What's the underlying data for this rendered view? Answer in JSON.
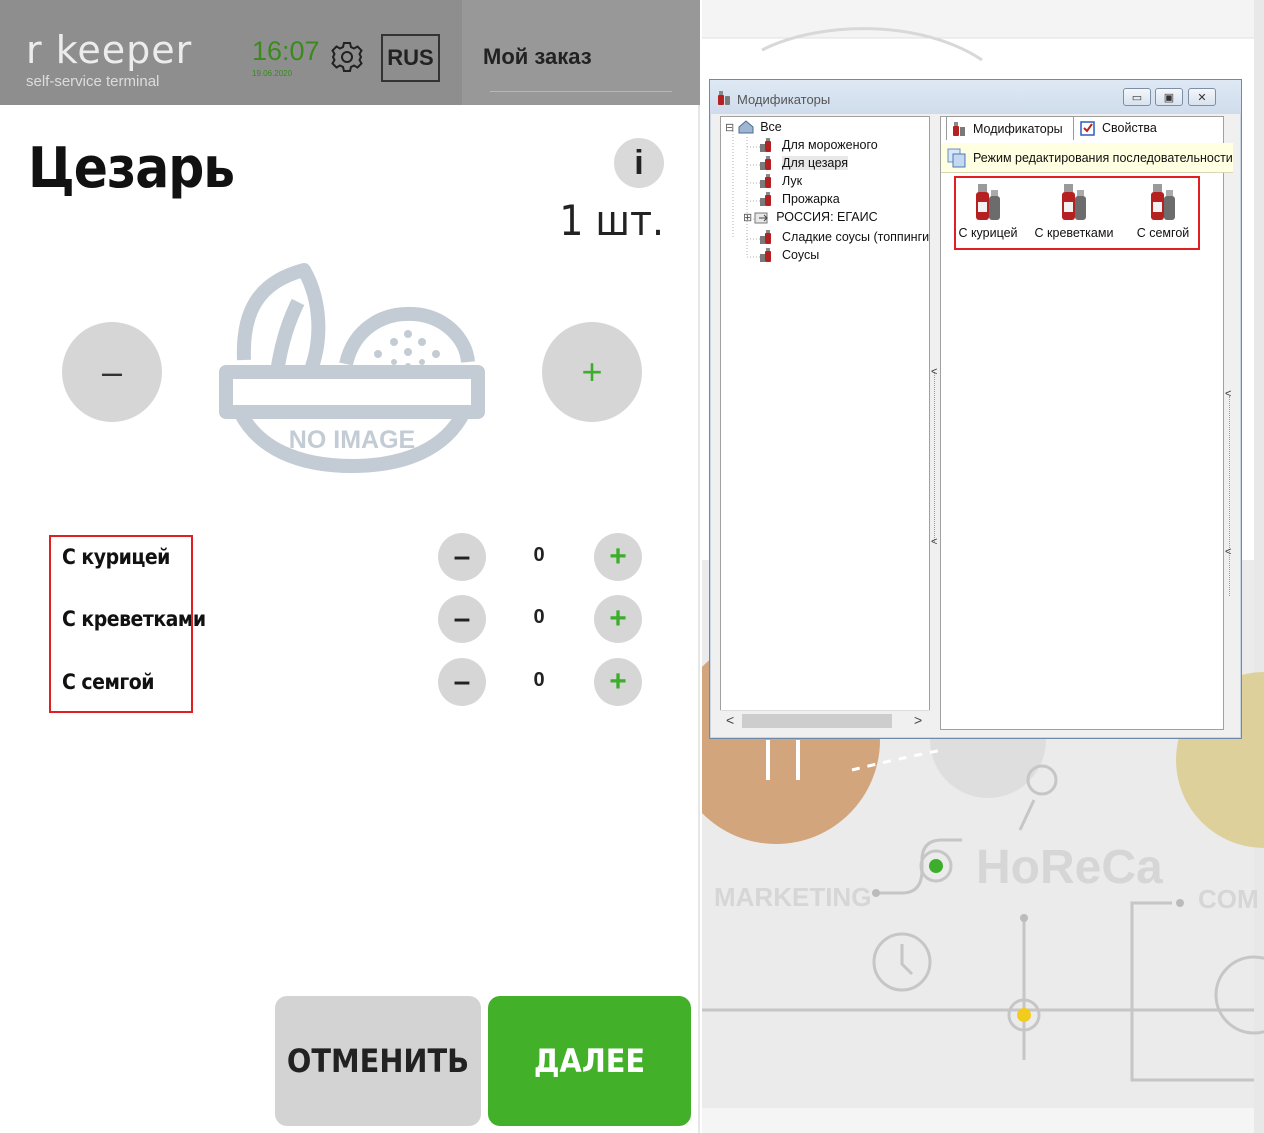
{
  "kiosk": {
    "logo": "r  keeper",
    "logo_sub": "self-service terminal",
    "time": "16:07",
    "date": "19.06.2020",
    "language": "RUS",
    "order_title": "Мой заказ",
    "dish_name": "Цезарь",
    "info_label": "i",
    "quantity": "1 шт.",
    "minus_label": "–",
    "plus_label": "+",
    "no_image_text": "NO IMAGE",
    "modifiers": [
      {
        "name": "С курицей",
        "count": "0",
        "minus": "–",
        "plus": "+"
      },
      {
        "name": "С креветками",
        "count": "0",
        "minus": "–",
        "plus": "+"
      },
      {
        "name": "С семгой",
        "count": "0",
        "minus": "–",
        "plus": "+"
      }
    ],
    "cancel_label": "ОТМЕНИТЬ",
    "next_label": "ДАЛЕЕ"
  },
  "background": {
    "horeca": "HoReCa",
    "marketing": "MARKETING",
    "com": "COM"
  },
  "dialog": {
    "title": "Модификаторы",
    "min_label": "▭",
    "max_label": "▣",
    "close_label": "✕",
    "tree": [
      {
        "label": "Все",
        "expander": "⊟"
      },
      {
        "label": "Для мороженого"
      },
      {
        "label": "Для цезаря"
      },
      {
        "label": "Лук"
      },
      {
        "label": "Прожарка"
      },
      {
        "label": "РОССИЯ: ЕГАИС",
        "expander": "⊞"
      },
      {
        "label": "Сладкие соусы (топпинги)"
      },
      {
        "label": "Соусы"
      }
    ],
    "tabs": [
      "Модификаторы",
      "Свойства"
    ],
    "mode_text": "Режим редактирования последовательности...",
    "items": [
      "С курицей",
      "С креветками",
      "С семгой"
    ],
    "scroll_left": "<",
    "scroll_right": ">",
    "splitter_arrow": "<"
  }
}
